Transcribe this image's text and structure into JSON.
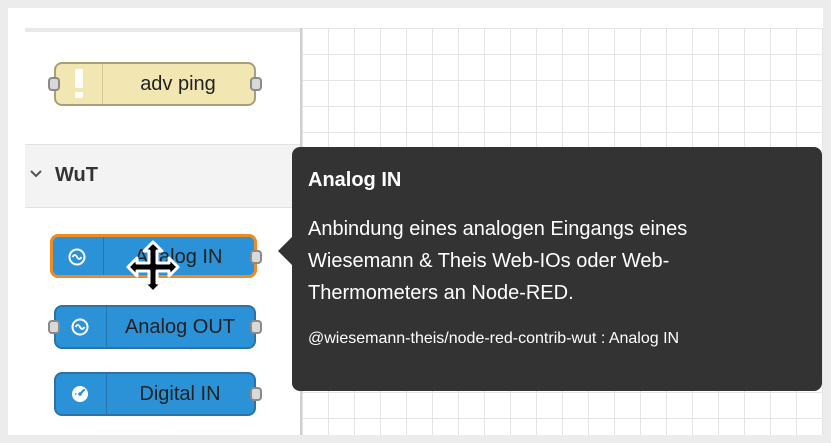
{
  "palette": {
    "nodes": [
      {
        "label": "adv ping",
        "color": "#f2e7b3",
        "icon": "warning-icon"
      }
    ],
    "category": {
      "label": "WuT",
      "nodes": [
        {
          "label": "Analog IN",
          "color": "#2b92d8",
          "icon": "wave-icon",
          "selected": true
        },
        {
          "label": "Analog OUT",
          "color": "#2b92d8",
          "icon": "wave-icon"
        },
        {
          "label": "Digital IN",
          "color": "#2b92d8",
          "icon": "gauge-icon"
        }
      ]
    }
  },
  "tooltip": {
    "title": "Analog IN",
    "description": "Anbindung eines analogen Eingangs eines Wiesemann & Theis Web-IOs oder Web-Thermometers an Node-RED.",
    "source": "@wiesemann-theis/node-red-contrib-wut : Analog IN"
  },
  "cursor": {
    "icon": "move-cursor-icon"
  }
}
